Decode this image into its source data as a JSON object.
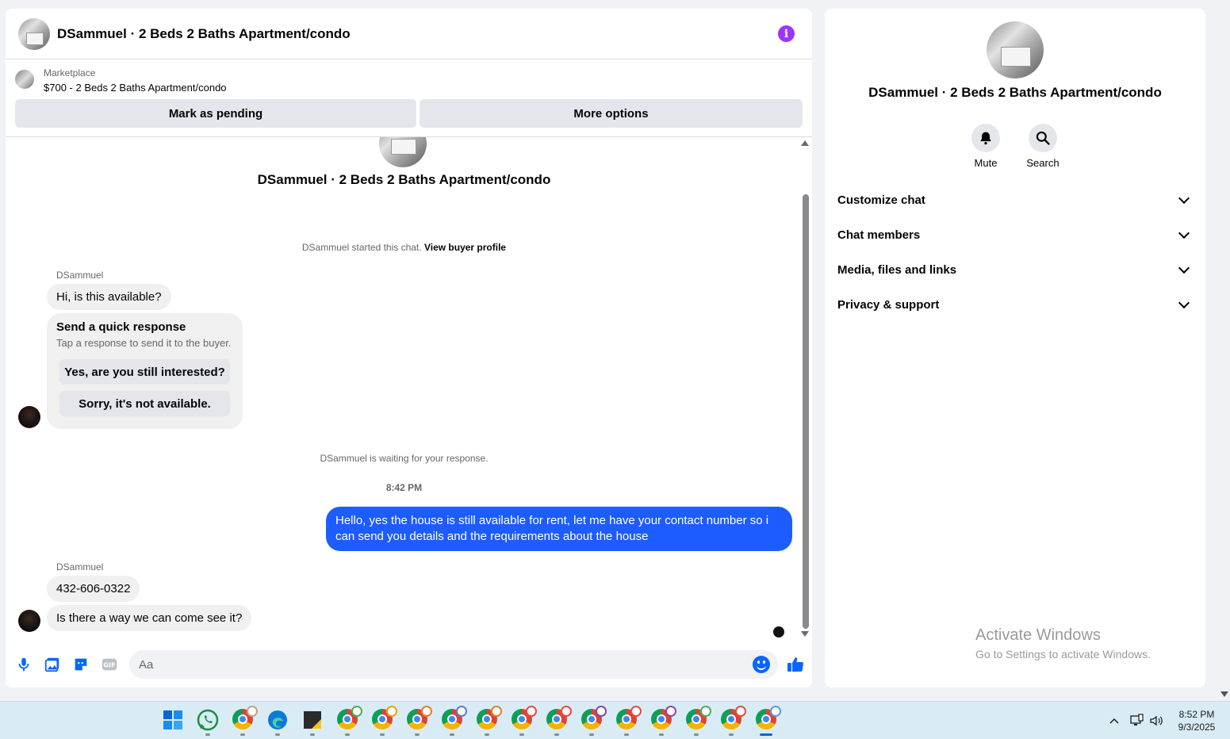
{
  "header": {
    "title": "DSammuel · 2 Beds 2 Baths Apartment/condo"
  },
  "marketplace": {
    "label": "Marketplace",
    "listing": "$700 - 2 Beds 2 Baths Apartment/condo",
    "mark_pending": "Mark as pending",
    "more_options": "More options"
  },
  "conversation": {
    "title": "DSammuel · 2 Beds 2 Baths Apartment/condo",
    "started_text": "DSammuel started this chat.",
    "view_profile": "View buyer profile",
    "sender1": "DSammuel",
    "msg1": "Hi, is this available?",
    "quick_title": "Send a quick response",
    "quick_sub": "Tap a response to send it to the buyer.",
    "quick_opt1": "Yes, are you still interested?",
    "quick_opt2": "Sorry, it's not available.",
    "waiting": "DSammuel is waiting for your response.",
    "time": "8:42 PM",
    "outgoing": "Hello, yes the house is still available for rent, let me have your contact number so i can send you details and the requirements about the house",
    "sender2": "DSammuel",
    "msg2": "432-606-0322",
    "msg3": "Is there a way we can come see it?"
  },
  "composer": {
    "placeholder": "Aa"
  },
  "side": {
    "title": "DSammuel · 2 Beds 2 Baths Apartment/condo",
    "mute": "Mute",
    "search": "Search",
    "sections": [
      "Customize chat",
      "Chat members",
      "Media, files and links",
      "Privacy & support"
    ]
  },
  "watermark": {
    "line1": "Activate Windows",
    "line2": "Go to Settings to activate Windows."
  },
  "taskbar": {
    "time": "8:52 PM",
    "date": "9/3/2025"
  },
  "colors": {
    "accent": "#0866ff",
    "outgoing_bubble": "#1d5cff",
    "info": "#a033ff"
  }
}
